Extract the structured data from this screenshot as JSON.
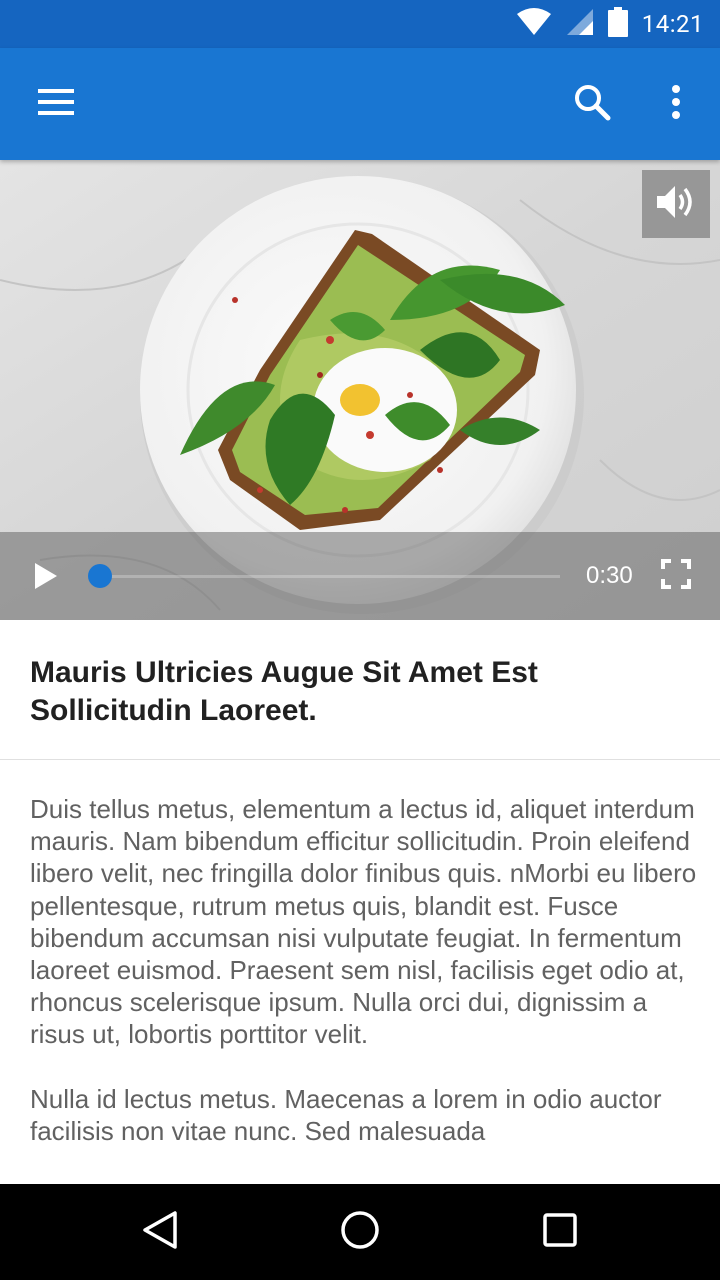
{
  "status_bar": {
    "time": "14:21",
    "icons": [
      "wifi-icon",
      "cell-signal-icon",
      "battery-icon"
    ]
  },
  "app_bar": {
    "icons": [
      "menu-icon",
      "search-icon",
      "more-vert-icon"
    ],
    "color": "#1976d2"
  },
  "video": {
    "duration": "0:30",
    "progress": 0,
    "icons": [
      "volume-icon",
      "play-icon",
      "fullscreen-icon"
    ]
  },
  "article": {
    "title": "Mauris Ultricies Augue Sit Amet Est Sollicitudin Laoreet.",
    "paragraphs": [
      "Duis tellus metus, elementum a lectus id, aliquet interdum mauris. Nam bibendum efficitur sollicitudin. Proin eleifend libero velit, nec fringilla dolor finibus quis. nMorbi eu libero pellentesque, rutrum metus quis, blandit est. Fusce bibendum accumsan nisi vulputate feugiat. In fermentum laoreet euismod. Praesent sem nisl, facilisis eget odio at, rhoncus scelerisque ipsum. Nulla orci dui, dignissim a risus ut, lobortis porttitor velit.",
      "Nulla id lectus metus. Maecenas a lorem in odio auctor facilisis non vitae nunc. Sed malesuada"
    ]
  },
  "nav_bar": {
    "icons": [
      "back-icon",
      "home-icon",
      "recents-icon"
    ]
  },
  "colors": {
    "status_bar": "#1565c0",
    "accent": "#1976d2",
    "title_text": "#212121",
    "body_text": "#616161"
  }
}
